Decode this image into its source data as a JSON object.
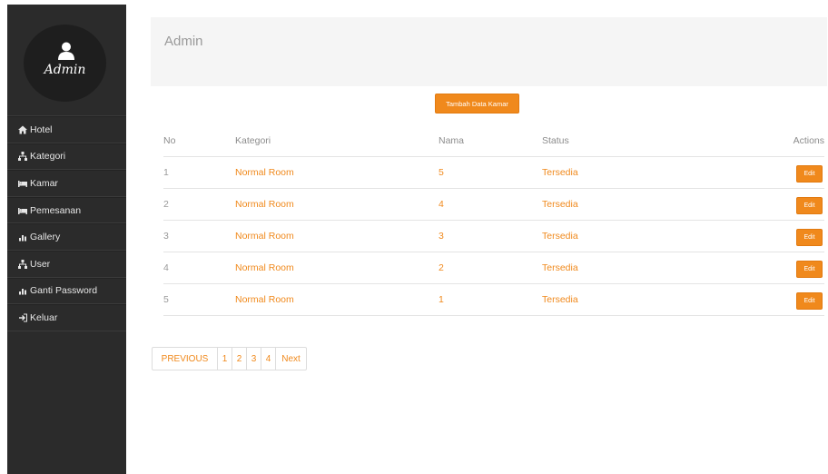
{
  "sidebar": {
    "profile_name": "Admin",
    "items": [
      {
        "label": "Hotel",
        "icon": "home-icon"
      },
      {
        "label": "Kategori",
        "icon": "sitemap-icon"
      },
      {
        "label": "Kamar",
        "icon": "bed-icon"
      },
      {
        "label": "Pemesanan",
        "icon": "bed-icon"
      },
      {
        "label": "Gallery",
        "icon": "bar-chart-icon"
      },
      {
        "label": "User",
        "icon": "sitemap-icon"
      },
      {
        "label": "Ganti Password",
        "icon": "bar-chart-icon"
      },
      {
        "label": "Keluar",
        "icon": "logout-icon"
      }
    ]
  },
  "header": {
    "title": "Admin"
  },
  "add_button": {
    "label": "Tambah Data Kamar"
  },
  "table": {
    "headers": {
      "no": "No",
      "kategori": "Kategori",
      "nama": "Nama",
      "status": "Status",
      "actions": "Actions"
    },
    "rows": [
      {
        "no": "1",
        "kategori": "Normal Room",
        "nama": "5",
        "status": "Tersedia",
        "action": "Edit"
      },
      {
        "no": "2",
        "kategori": "Normal Room",
        "nama": "4",
        "status": "Tersedia",
        "action": "Edit"
      },
      {
        "no": "3",
        "kategori": "Normal Room",
        "nama": "3",
        "status": "Tersedia",
        "action": "Edit"
      },
      {
        "no": "4",
        "kategori": "Normal Room",
        "nama": "2",
        "status": "Tersedia",
        "action": "Edit"
      },
      {
        "no": "5",
        "kategori": "Normal Room",
        "nama": "1",
        "status": "Tersedia",
        "action": "Edit"
      }
    ]
  },
  "pagination": {
    "previous": "PREVIOUS",
    "pages": [
      "1",
      "2",
      "3",
      "4"
    ],
    "next": "Next"
  },
  "colors": {
    "sidebar_bg": "#2b2b2b",
    "accent": "#f0891c",
    "header_bg": "#f5f5f5"
  }
}
